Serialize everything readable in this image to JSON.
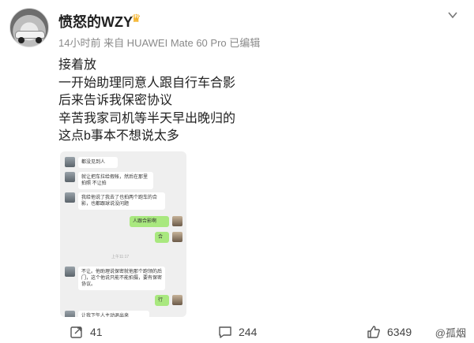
{
  "post": {
    "username": "愤怒的WZY",
    "meta": "14小时前  来自 HUAWEI Mate 60 Pro  已编辑",
    "lines": [
      "接着放",
      "一开始助理同意人跟自行车合影",
      "后来告诉我保密协议",
      "辛苦我家司机等半天早出晚归的",
      "这点b事本不想说太多"
    ]
  },
  "chat": {
    "messages": [
      {
        "side": "left",
        "text": "都没见到人"
      },
      {
        "side": "left",
        "text": "就让把车拉给假帐，然后在那里拍照 不让拍"
      },
      {
        "side": "left",
        "text": "我给他说了我去了也拍两个跑车的合影，也都跟球说没问题"
      },
      {
        "side": "right",
        "text": "人跟合影啊"
      },
      {
        "side": "right",
        "text": "合"
      },
      {
        "side": "left",
        "text": "不让。他助理说保密就他那个跑领的后门，这个他说只能不能拍摄，要有保密协议。"
      },
      {
        "side": "right",
        "text": "行"
      },
      {
        "side": "left",
        "text": "让我下午人主动退出来"
      }
    ],
    "time": "上午11:17"
  },
  "actions": {
    "repost": "41",
    "comment": "244",
    "like": "6349"
  },
  "watermark": "@孤烟",
  "colors": {
    "crown": "#f2a400",
    "meta": "#8a8a8a",
    "chat_green": "#a9e87f"
  }
}
